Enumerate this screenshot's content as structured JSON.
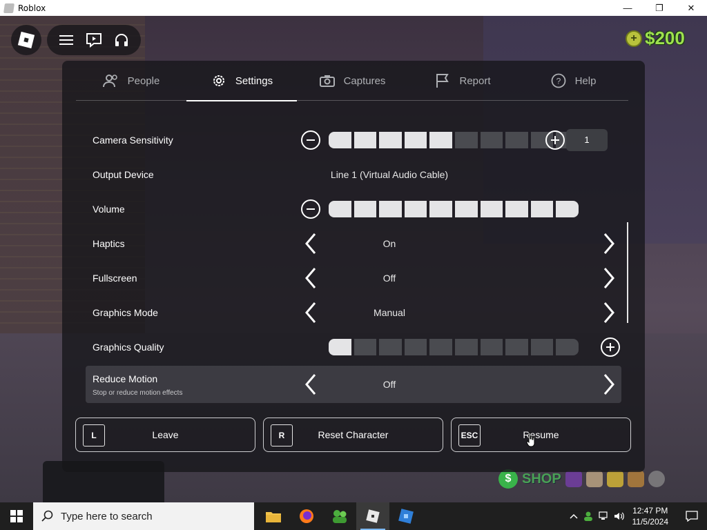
{
  "window": {
    "title": "Roblox",
    "controls": {
      "minimize": "—",
      "maximize": "❐",
      "close": "✕"
    }
  },
  "hud": {
    "money": "$200",
    "coin_symbol": "+",
    "shop_label": "SHOP",
    "shop_symbol": "$"
  },
  "menu": {
    "tabs": [
      {
        "label": "People",
        "icon": "people-icon"
      },
      {
        "label": "Settings",
        "icon": "gear-icon",
        "active": true
      },
      {
        "label": "Captures",
        "icon": "camera-icon"
      },
      {
        "label": "Report",
        "icon": "flag-icon"
      },
      {
        "label": "Help",
        "icon": "help-icon"
      }
    ],
    "settings": {
      "camera_sensitivity": {
        "label": "Camera Sensitivity",
        "value": "1",
        "level": 5,
        "segments": 10
      },
      "output_device": {
        "label": "Output Device",
        "value": "Line 1 (Virtual Audio Cable)"
      },
      "volume": {
        "label": "Volume",
        "level": 10,
        "segments": 10
      },
      "haptics": {
        "label": "Haptics",
        "value": "On"
      },
      "fullscreen": {
        "label": "Fullscreen",
        "value": "Off"
      },
      "graphics_mode": {
        "label": "Graphics Mode",
        "value": "Manual"
      },
      "graphics_quality": {
        "label": "Graphics Quality",
        "level": 1,
        "segments": 10
      },
      "reduce_motion": {
        "label": "Reduce Motion",
        "value": "Off",
        "description": "Stop or reduce motion effects"
      }
    },
    "actions": [
      {
        "key": "L",
        "label": "Leave"
      },
      {
        "key": "R",
        "label": "Reset Character"
      },
      {
        "key": "ESC",
        "label": "Resume"
      }
    ]
  },
  "taskbar": {
    "search_placeholder": "Type here to search",
    "time": "12:47 PM",
    "date": "11/5/2024"
  },
  "colors": {
    "money_green": "#9ee14f",
    "slider_on": "#e4e4e6",
    "slider_off": "#4a4b50",
    "taskbar": "#1f1f1f"
  }
}
